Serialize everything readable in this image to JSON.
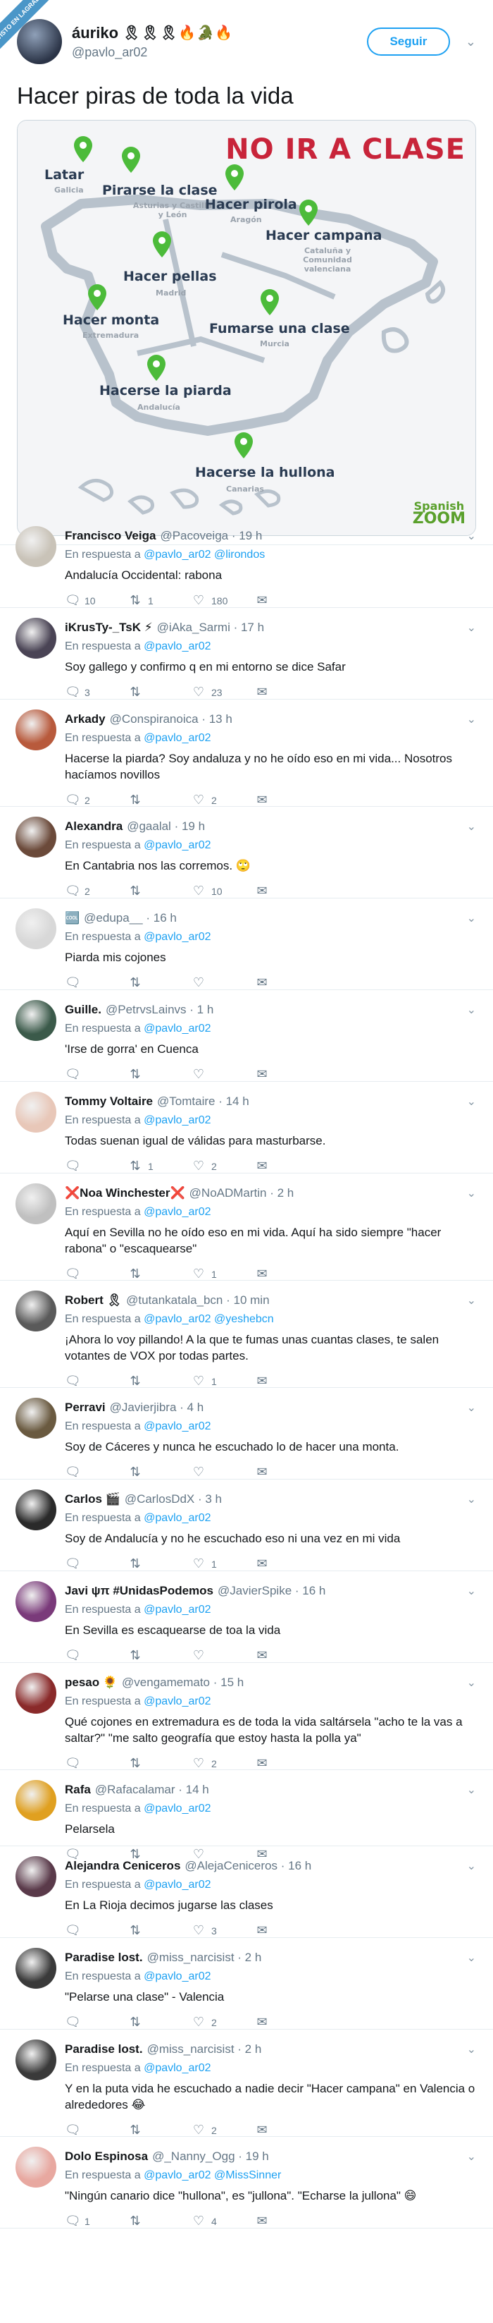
{
  "ribbon": "VISTO EN LAGRADA",
  "main_tweet": {
    "name": "áuriko",
    "name_emojis": "🎗🎗🎗🔥🐊🔥",
    "handle": "@pavlo_ar02",
    "follow_label": "Seguir",
    "text": "Hacer piras de toda la vida",
    "map": {
      "title": "NO IR A CLASE",
      "logo_top": "Spanish",
      "logo_bottom": "ZOOM",
      "labels": [
        {
          "phrase": "Latar",
          "region": "Galicia"
        },
        {
          "phrase": "Pirarse la clase",
          "region": "Asturias y Castilla y León"
        },
        {
          "phrase": "Hacer pirola",
          "region": "Aragón"
        },
        {
          "phrase": "Hacer campana",
          "region": "Cataluña y Comunidad valenciana"
        },
        {
          "phrase": "Hacer pellas",
          "region": "Madrid"
        },
        {
          "phrase": "Hacer monta",
          "region": "Extremadura"
        },
        {
          "phrase": "Fumarse una clase",
          "region": "Murcia"
        },
        {
          "phrase": "Hacerse la piarda",
          "region": "Andalucía"
        },
        {
          "phrase": "Hacerse la hullona",
          "region": "Canarias"
        }
      ],
      "pin_color": "#4cbb3a",
      "outline_color": "#b8c2cc"
    }
  },
  "colors": {
    "link": "#1da1f2",
    "muted": "#657786",
    "accent_heart": "#e0245e"
  },
  "replies": [
    {
      "name": "Francisco Veiga",
      "handle": "@Pacoveiga",
      "time": "· 19 h",
      "reply_to": [
        "@pavlo_ar02",
        "@lirondos"
      ],
      "text": "Andalucía Occidental: rabona",
      "replies": "10",
      "retweets": "1",
      "likes": "180",
      "avatar": "#c9c3b8"
    },
    {
      "name": "iKrusTy-_TsK ⚡",
      "handle": "@iAka_Sarmi",
      "time": "· 17 h",
      "reply_to": [
        "@pavlo_ar02"
      ],
      "text": "Soy gallego y confirmo q en mi entorno se dice Safar",
      "replies": "3",
      "retweets": "",
      "likes": "23",
      "avatar": "#4a4455"
    },
    {
      "name": "Arkady",
      "handle": "@Conspiranoica",
      "time": "· 13 h",
      "reply_to": [
        "@pavlo_ar02"
      ],
      "text": "Hacerse la piarda? Soy andaluza y no he oído eso en mi vida... Nosotros hacíamos novillos",
      "replies": "2",
      "retweets": "",
      "likes": "2",
      "avatar": "#b85a3c"
    },
    {
      "name": "Alexandra",
      "handle": "@gaalal",
      "time": "· 19 h",
      "reply_to": [
        "@pavlo_ar02"
      ],
      "text": "En Cantabria nos las corremos. 🙄",
      "replies": "2",
      "retweets": "",
      "likes": "10",
      "avatar": "#6b4a3a"
    },
    {
      "name": "🆒",
      "handle": "@edupa__",
      "time": "· 16 h",
      "reply_to": [
        "@pavlo_ar02"
      ],
      "text": "Piarda mis cojones",
      "replies": "",
      "retweets": "",
      "likes": "",
      "avatar": "#d8d8d8"
    },
    {
      "name": "Guille.",
      "handle": "@PetrvsLainvs",
      "time": "· 1 h",
      "reply_to": [
        "@pavlo_ar02"
      ],
      "text": "'Irse de gorra' en Cuenca",
      "replies": "",
      "retweets": "",
      "likes": "",
      "avatar": "#3b5a4a"
    },
    {
      "name": "Tommy Voltaire",
      "handle": "@Tomtaire",
      "time": "· 14 h",
      "reply_to": [
        "@pavlo_ar02"
      ],
      "text": "Todas suenan igual de válidas para masturbarse.",
      "replies": "",
      "retweets": "1",
      "likes": "2",
      "avatar": "#e8c7b8"
    },
    {
      "name": "❌Noa Winchester❌",
      "handle": "@NoADMartin",
      "time": "· 2 h",
      "reply_to": [
        "@pavlo_ar02"
      ],
      "text": "Aquí en Sevilla no he oído eso en mi vida. Aquí ha sido siempre \"hacer rabona\" o \"escaquearse\"",
      "replies": "",
      "retweets": "",
      "likes": "1",
      "avatar": "#c0c0c0"
    },
    {
      "name": "Robert 🎗",
      "handle": "@tutankatala_bcn",
      "time": "· 10 min",
      "reply_to": [
        "@pavlo_ar02",
        "@yeshebcn"
      ],
      "text": "¡Ahora lo voy pillando! A la que te fumas unas cuantas clases, te salen votantes de VOX por todas partes.",
      "replies": "",
      "retweets": "",
      "likes": "1",
      "avatar": "#5a5a5a"
    },
    {
      "name": "Perravi",
      "handle": "@Javierjibra",
      "time": "· 4 h",
      "reply_to": [
        "@pavlo_ar02"
      ],
      "text": "Soy de Cáceres y nunca he escuchado lo de hacer una monta.",
      "replies": "",
      "retweets": "",
      "likes": "",
      "avatar": "#6a5a40"
    },
    {
      "name": "Carlos 🎬",
      "handle": "@CarlosDdX",
      "time": "· 3 h",
      "reply_to": [
        "@pavlo_ar02"
      ],
      "text": "Soy de Andalucía y no he escuchado eso ni una vez en mi vida",
      "replies": "",
      "retweets": "",
      "likes": "1",
      "avatar": "#2a2a2a"
    },
    {
      "name": "Javi ψπ #UnidasPodemos",
      "handle": "@JavierSpike",
      "time": "· 16 h",
      "reply_to": [
        "@pavlo_ar02"
      ],
      "text": "En Sevilla es escaquearse de toa la vida",
      "replies": "",
      "retweets": "",
      "likes": "",
      "avatar": "#7a3a7a"
    },
    {
      "name": "pesao 🌻",
      "handle": "@vengamemato",
      "time": "· 15 h",
      "reply_to": [
        "@pavlo_ar02"
      ],
      "text": "Qué cojones en extremadura es de toda la vida saltársela \"acho te la vas a saltar?\" \"me salto geografía que estoy hasta la polla ya\"",
      "replies": "",
      "retweets": "",
      "likes": "2",
      "avatar": "#8a2a2a"
    },
    {
      "name": "Rafa",
      "handle": "@Rafacalamar",
      "time": "· 14 h",
      "reply_to": [
        "@pavlo_ar02"
      ],
      "text": "Pelarsela",
      "replies": "",
      "retweets": "",
      "likes": "",
      "avatar": "#e0a020"
    },
    {
      "name": "Alejandra Ceniceros",
      "handle": "@AlejaCeniceros",
      "time": "· 16 h",
      "reply_to": [
        "@pavlo_ar02"
      ],
      "text": "En La Rioja decimos jugarse las clases",
      "replies": "",
      "retweets": "",
      "likes": "3",
      "avatar": "#5a3a4a"
    },
    {
      "name": "Paradise lost.",
      "handle": "@miss_narcisist",
      "time": "· 2 h",
      "reply_to": [
        "@pavlo_ar02"
      ],
      "text": "\"Pelarse una clase\"  - Valencia",
      "replies": "",
      "retweets": "",
      "likes": "2",
      "avatar": "#3a3a3a"
    },
    {
      "name": "Paradise lost.",
      "handle": "@miss_narcisist",
      "time": "· 2 h",
      "reply_to": [
        "@pavlo_ar02"
      ],
      "text": "Y en la puta vida he escuchado a nadie decir \"Hacer campana\" en Valencia o alrededores 😂",
      "replies": "",
      "retweets": "",
      "likes": "2",
      "avatar": "#3a3a3a"
    },
    {
      "name": "Dolo Espinosa",
      "handle": "@_Nanny_Ogg",
      "time": "· 19 h",
      "reply_to": [
        "@pavlo_ar02",
        "@MissSinner"
      ],
      "text": "\"Ningún canario dice \"hullona\", es \"jullona\". \"Echarse la jullona\" 😄",
      "replies": "1",
      "retweets": "",
      "likes": "4",
      "avatar": "#e8a8a0"
    }
  ],
  "labels": {
    "in_reply_to": "En respuesta a",
    "and": " "
  }
}
